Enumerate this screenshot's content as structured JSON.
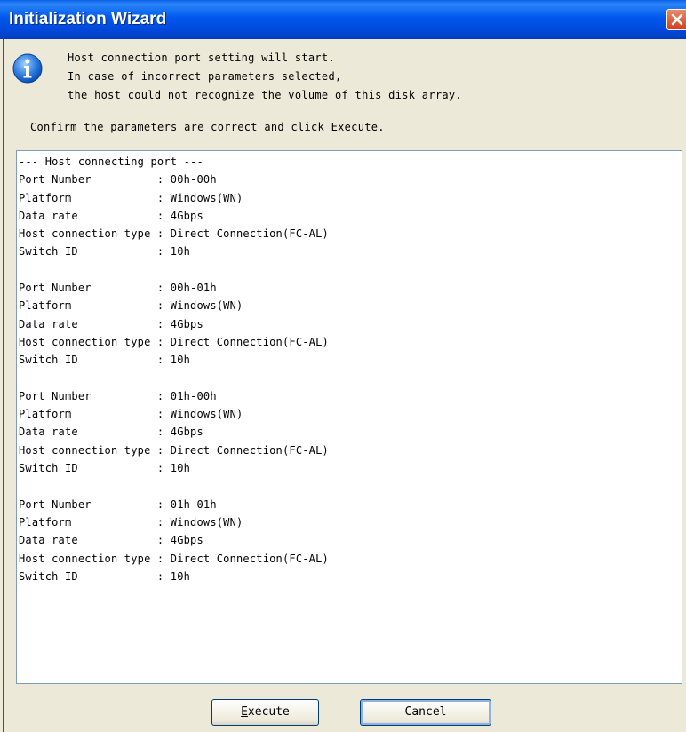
{
  "window": {
    "title": "Initialization Wizard",
    "close_icon": "close-icon"
  },
  "message": {
    "icon": "info-icon",
    "lines": [
      "Host connection port setting will start.",
      "In case of incorrect parameters selected,",
      "the host could not recognize the volume of this disk array."
    ],
    "confirm": "Confirm the parameters are correct and click Execute."
  },
  "details": {
    "header": "--- Host connecting port ---",
    "ports": [
      {
        "port_number": "Port Number          : 00h-00h",
        "platform": "Platform             : Windows(WN)",
        "data_rate": "Data rate            : 4Gbps",
        "connection_type": "Host connection type : Direct Connection(FC-AL)",
        "switch_id": "Switch ID            : 10h"
      },
      {
        "port_number": "Port Number          : 00h-01h",
        "platform": "Platform             : Windows(WN)",
        "data_rate": "Data rate            : 4Gbps",
        "connection_type": "Host connection type : Direct Connection(FC-AL)",
        "switch_id": "Switch ID            : 10h"
      },
      {
        "port_number": "Port Number          : 01h-00h",
        "platform": "Platform             : Windows(WN)",
        "data_rate": "Data rate            : 4Gbps",
        "connection_type": "Host connection type : Direct Connection(FC-AL)",
        "switch_id": "Switch ID            : 10h"
      },
      {
        "port_number": "Port Number          : 01h-01h",
        "platform": "Platform             : Windows(WN)",
        "data_rate": "Data rate            : 4Gbps",
        "connection_type": "Host connection type : Direct Connection(FC-AL)",
        "switch_id": "Switch ID            : 10h"
      }
    ]
  },
  "buttons": {
    "execute_mnemonic": "E",
    "execute_rest": "xecute",
    "cancel": "Cancel"
  }
}
